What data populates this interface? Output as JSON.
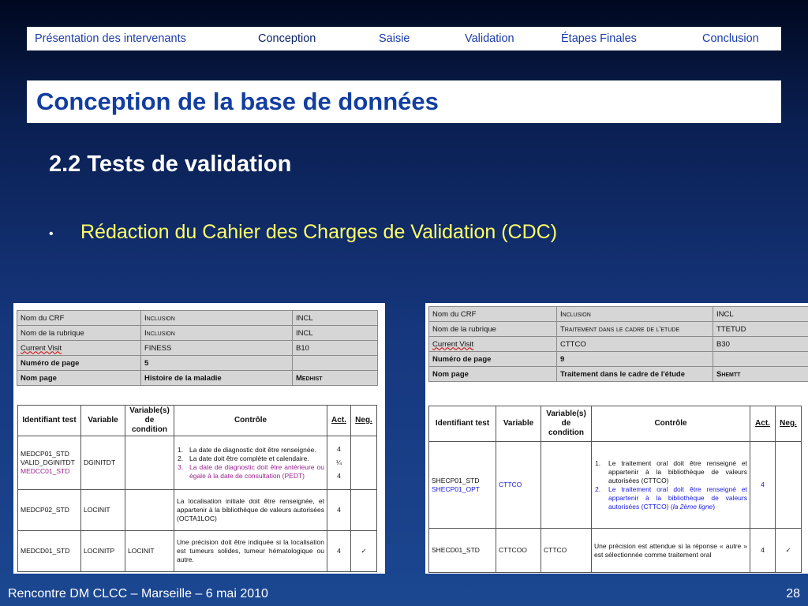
{
  "nav": {
    "items": [
      "Présentation des intervenants",
      "Conception",
      "Saisie",
      "Validation",
      "Étapes Finales",
      "Conclusion"
    ]
  },
  "slide": {
    "title": "Conception de la base de données",
    "subtitle": "2.2 Tests de validation",
    "bullet_marker": "•",
    "bullet": "Rédaction du Cahier des Charges de Validation (CDC)"
  },
  "doc1": {
    "info": [
      [
        "Nom du CRF",
        "Inclusion",
        "INCL"
      ],
      [
        "Nom de la rubrique",
        "Inclusion",
        "INCL"
      ],
      [
        "Current Visit",
        "FINESS",
        "B10"
      ],
      [
        "Numéro de page",
        "5",
        ""
      ],
      [
        "Nom page",
        "Histoire de la maladie",
        "Medhist"
      ]
    ],
    "headers": [
      "Identifiant test",
      "Variable",
      "Variable(s) de condition",
      "Contrôle",
      "Act.",
      "Neg."
    ],
    "rows": [
      {
        "ids": [
          "MEDCP01_STD",
          "VALID_DGINITDT",
          "MEDCC01_STD"
        ],
        "variable": "DGINITDT",
        "condition": "",
        "controls": [
          {
            "n": "1.",
            "text": "La date de diagnostic doit être renseignée."
          },
          {
            "n": "2.",
            "text": "La date doit être complète et calendaire."
          },
          {
            "n": "3.",
            "text": "La date de diagnostic doit être antérieure ou égale à la date de consultation (PEDT)"
          }
        ],
        "act": [
          "4",
          "¼",
          "4"
        ],
        "neg": ""
      },
      {
        "id": "MEDCP02_STD",
        "variable": "LOCINIT",
        "condition": "",
        "control": "La localisation initiale doit être renseignée, et appartenir à la bibliothèque de valeurs autorisées (OCTA1LOC)",
        "act": "4",
        "neg": ""
      },
      {
        "id": "MEDCD01_STD",
        "variable": "LOCINITP",
        "condition": "LOCINIT",
        "control": "Une précision doit être indiquée si la localisation est tumeurs solides, tumeur hématologique ou autre.",
        "act": "4",
        "neg": "✓"
      }
    ]
  },
  "doc2": {
    "info": [
      [
        "Nom du CRF",
        "Inclusion",
        "INCL"
      ],
      [
        "Nom de la rubrique",
        "Traitement dans le cadre de l'etude",
        "TTETUD"
      ],
      [
        "Current Visit",
        "CTTCO",
        "B30"
      ],
      [
        "Numéro de page",
        "9",
        ""
      ],
      [
        "Nom page",
        "Traitement dans le cadre de l'étude",
        "Shemtt"
      ]
    ],
    "headers": [
      "Identifiant test",
      "Variable",
      "Variable(s) de condition",
      "Contrôle",
      "Act.",
      "Neg."
    ],
    "rows": [
      {
        "ids": [
          "SHECP01_STD",
          "SHECP01_OPT"
        ],
        "variable": "CTTCO",
        "condition": "",
        "controls": [
          {
            "n": "1.",
            "text": "Le traitement oral doit être renseigné et appartenir à la bibliothèque de valeurs autorisées (CTTCO)"
          },
          {
            "n": "2.",
            "text": "Le traitement oral doit être renseigné et appartenir à la bibliothèque de valeurs autorisées (CTTCO) (",
            "italic": "la 2ème ligne",
            "end": ")"
          }
        ],
        "act": "4",
        "neg": ""
      },
      {
        "id": "SHECD01_STD",
        "variable": "CTTCOO",
        "condition": "CTTCO",
        "control": "Une précision est attendue si la réponse « autre » est sélectionnée comme traitement oral",
        "act": "4",
        "neg": "✓"
      }
    ]
  },
  "footer": {
    "left": "Rencontre DM CLCC – Marseille – 6 mai 2010",
    "page": "28"
  },
  "colors": {
    "title_blue": "#123ea0",
    "bullet_yellow": "#ffff66",
    "nav_blue": "#1a3ca8",
    "magenta": "#9b2191",
    "blue_text": "#1a1ae0"
  }
}
